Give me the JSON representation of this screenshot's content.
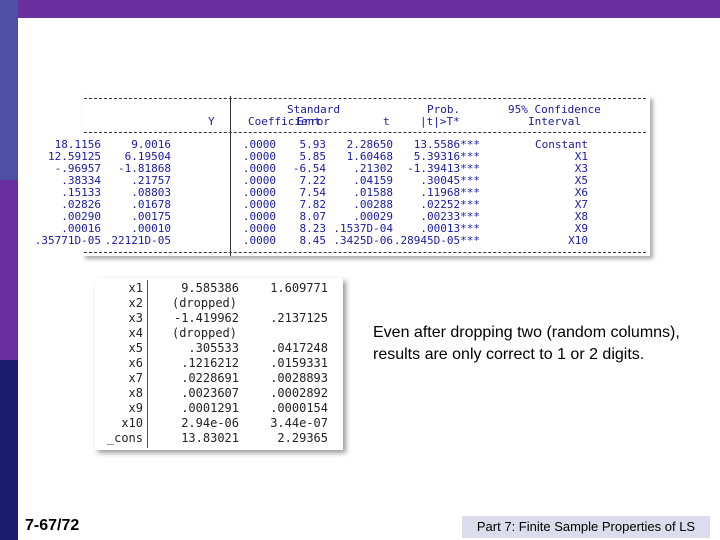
{
  "colors": {
    "band": "#6a2f9e",
    "footer_bg": "#dcdcec",
    "output_text": "#1a1aa0"
  },
  "output1": {
    "headers": {
      "y": "Y",
      "coef": "Coefficient",
      "se_top": "Standard",
      "se_bot": "Error",
      "t": "t",
      "p_top": "Prob.",
      "p_bot": "|t|>T*",
      "ci_top": "95% Confidence",
      "ci_bot": "Interval"
    },
    "rows": [
      {
        "var": "Constant",
        "coef": "13.5586***",
        "se": "2.28650",
        "t": "5.93",
        "p": ".0000",
        "lo": "9.0016",
        "hi": "18.1156"
      },
      {
        "var": "X1",
        "coef": "5.39316***",
        "se": "1.60468",
        "t": "5.85",
        "p": ".0000",
        "lo": "6.19504",
        "hi": "12.59125"
      },
      {
        "var": "X3",
        "coef": "-1.39413***",
        "se": ".21302",
        "t": "-6.54",
        "p": ".0000",
        "lo": "-1.81868",
        "hi": "-.96957"
      },
      {
        "var": "X5",
        "coef": ".30045***",
        "se": ".04159",
        "t": "7.22",
        "p": ".0000",
        "lo": ".21757",
        "hi": ".38334"
      },
      {
        "var": "X6",
        "coef": ".11968***",
        "se": ".01588",
        "t": "7.54",
        "p": ".0000",
        "lo": ".08803",
        "hi": ".15133"
      },
      {
        "var": "X7",
        "coef": ".02252***",
        "se": ".00288",
        "t": "7.82",
        "p": ".0000",
        "lo": ".01678",
        "hi": ".02826"
      },
      {
        "var": "X8",
        "coef": ".00233***",
        "se": ".00029",
        "t": "8.07",
        "p": ".0000",
        "lo": ".00175",
        "hi": ".00290"
      },
      {
        "var": "X9",
        "coef": ".00013***",
        "se": ".1537D-04",
        "t": "8.23",
        "p": ".0000",
        "lo": ".00010",
        "hi": ".00016"
      },
      {
        "var": "X10",
        "coef": ".28945D-05***",
        "se": ".3425D-06",
        "t": "8.45",
        "p": ".0000",
        "lo": ".22121D-05",
        "hi": ".35771D-05"
      }
    ]
  },
  "output2": {
    "rows": [
      {
        "var": "x1",
        "coef": "9.585386",
        "se": "1.609771"
      },
      {
        "var": "x2",
        "coef": "(dropped)",
        "se": ""
      },
      {
        "var": "x3",
        "coef": "-1.419962",
        "se": ".2137125"
      },
      {
        "var": "x4",
        "coef": "(dropped)",
        "se": ""
      },
      {
        "var": "x5",
        "coef": ".305533",
        "se": ".0417248"
      },
      {
        "var": "x6",
        "coef": ".1216212",
        "se": ".0159331"
      },
      {
        "var": "x7",
        "coef": ".0228691",
        "se": ".0028893"
      },
      {
        "var": "x8",
        "coef": ".0023607",
        "se": ".0002892"
      },
      {
        "var": "x9",
        "coef": ".0001291",
        "se": ".0000154"
      },
      {
        "var": "x10",
        "coef": "2.94e-06",
        "se": "3.44e-07"
      },
      {
        "var": "_cons",
        "coef": "13.83021",
        "se": "2.29365"
      }
    ]
  },
  "note": "Even after dropping two (random columns), results are only correct to 1 or 2 digits.",
  "slide_number": "7-67/72",
  "footer": "Part 7: Finite Sample Properties of LS"
}
